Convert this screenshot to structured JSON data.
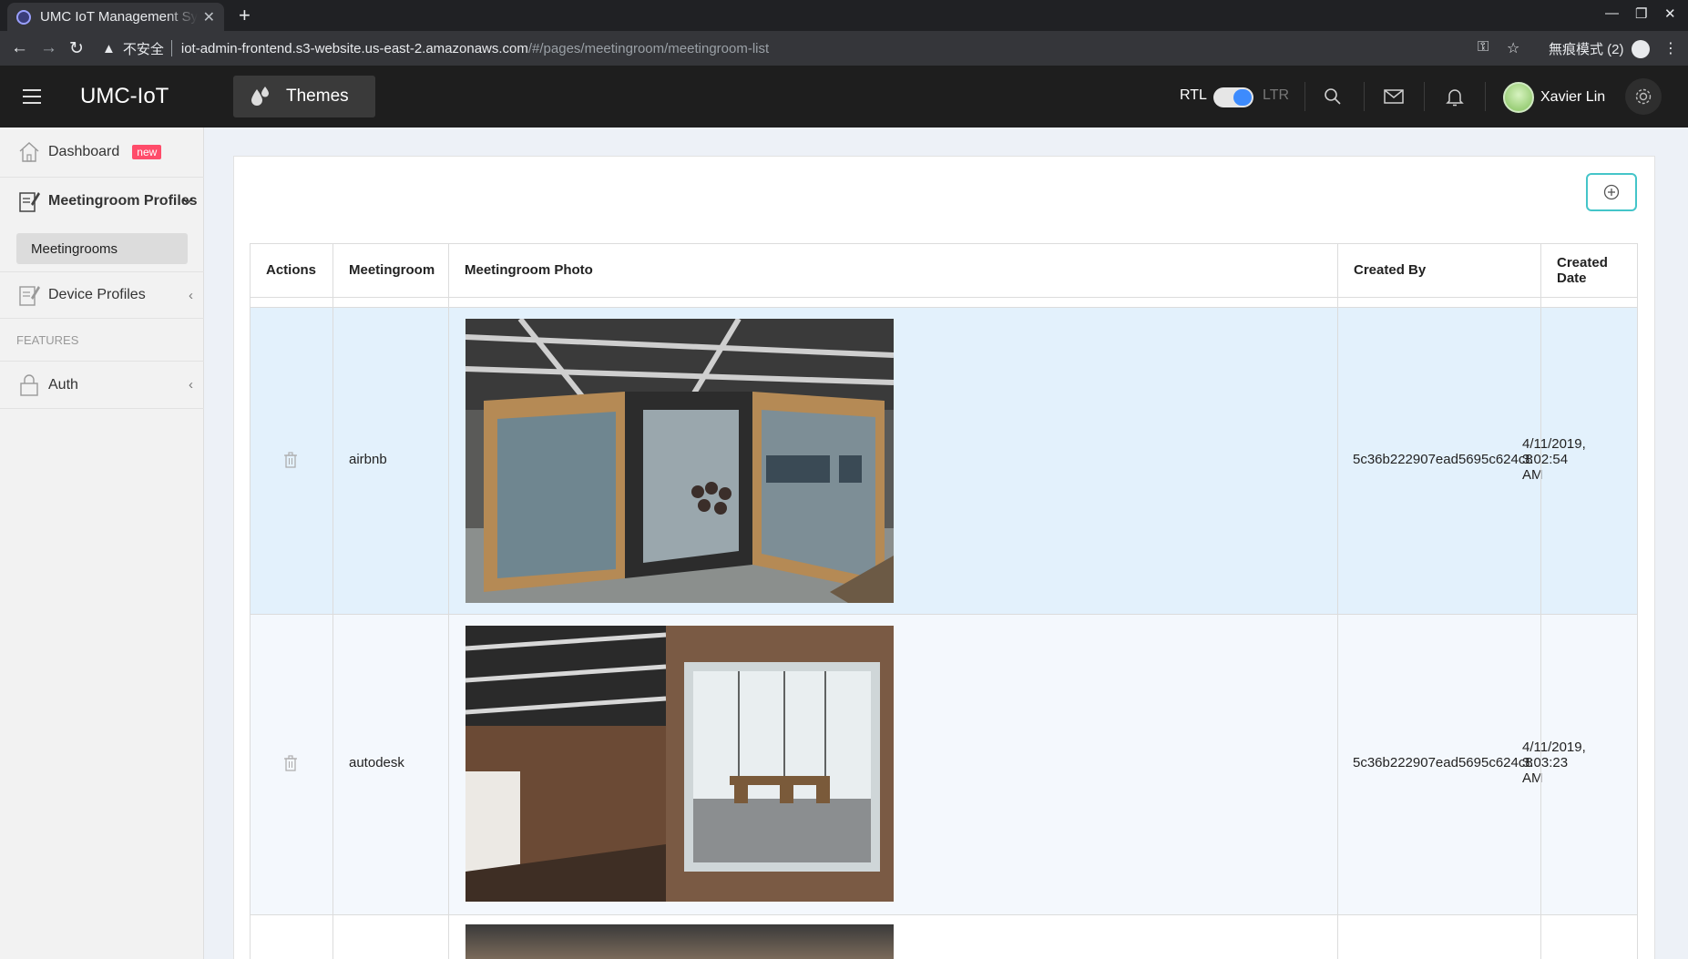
{
  "browser": {
    "tab_title": "UMC IoT Management System",
    "url_warning": "不安全",
    "url_host": "iot-admin-frontend.s3-website.us-east-2.amazonaws.com",
    "url_path": "/#/pages/meetingroom/meetingroom-list",
    "incognito_label": "無痕模式 (2)"
  },
  "header": {
    "brand": "UMC-IoT",
    "themes_label": "Themes",
    "rtl_label": "RTL",
    "ltr_label": "LTR",
    "user_name": "Xavier Lin"
  },
  "sidebar": {
    "dashboard": "Dashboard",
    "dashboard_badge": "new",
    "meetingroom_profiles": "Meetingroom Profiles",
    "meetingrooms": "Meetingrooms",
    "device_profiles": "Device Profiles",
    "features_section": "FEATURES",
    "auth": "Auth"
  },
  "table": {
    "headers": {
      "actions": "Actions",
      "meetingroom": "Meetingroom",
      "photo": "Meetingroom Photo",
      "created_by": "Created By",
      "created_date_1": "Created",
      "created_date_2": "Date"
    },
    "rows": [
      {
        "name": "airbnb",
        "created_by": "5c36b222907ead5695c624c8",
        "date_1": "4/11/2019,",
        "date_2": "3:02:54",
        "date_3": "AM"
      },
      {
        "name": "autodesk",
        "created_by": "5c36b222907ead5695c624c8",
        "date_1": "4/11/2019,",
        "date_2": "3:03:23",
        "date_3": "AM"
      }
    ]
  },
  "colors": {
    "header_bg": "#1e1e1e",
    "accent_teal": "#44c5c9",
    "selected_row": "#e3f1fc",
    "badge_red": "#ff4c6a",
    "toggle_blue": "#3d8bfd"
  }
}
